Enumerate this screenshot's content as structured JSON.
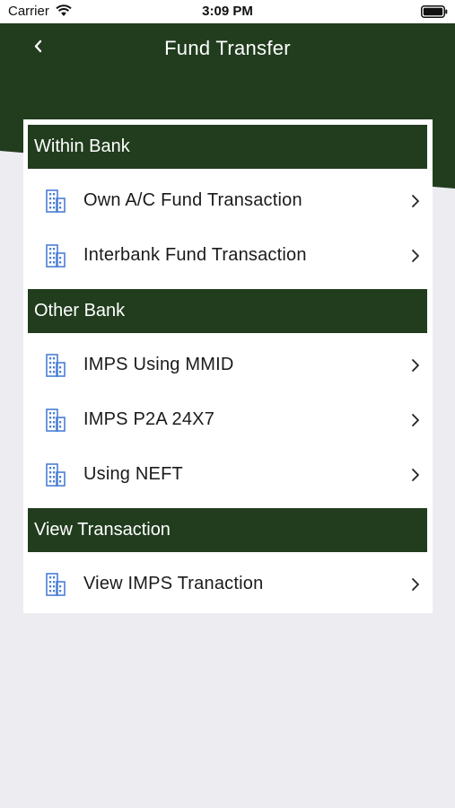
{
  "status_bar": {
    "carrier": "Carrier",
    "time": "3:09 PM"
  },
  "nav": {
    "title": "Fund Transfer",
    "back_icon": "chevron-left-icon"
  },
  "colors": {
    "primary_dark_green": "#213d1e",
    "icon_blue": "#4a7fd4",
    "background": "#ececf1"
  },
  "sections": [
    {
      "title": "Within Bank",
      "items": [
        {
          "label": "Own A/C Fund Transaction",
          "icon": "building-icon"
        },
        {
          "label": "Interbank Fund Transaction",
          "icon": "building-icon"
        }
      ]
    },
    {
      "title": "Other Bank",
      "items": [
        {
          "label": "IMPS Using MMID",
          "icon": "building-icon"
        },
        {
          "label": "IMPS P2A 24X7",
          "icon": "building-icon"
        },
        {
          "label": "Using NEFT",
          "icon": "building-icon"
        }
      ]
    },
    {
      "title": "View Transaction",
      "items": [
        {
          "label": "View IMPS Tranaction",
          "icon": "building-icon"
        }
      ]
    }
  ]
}
